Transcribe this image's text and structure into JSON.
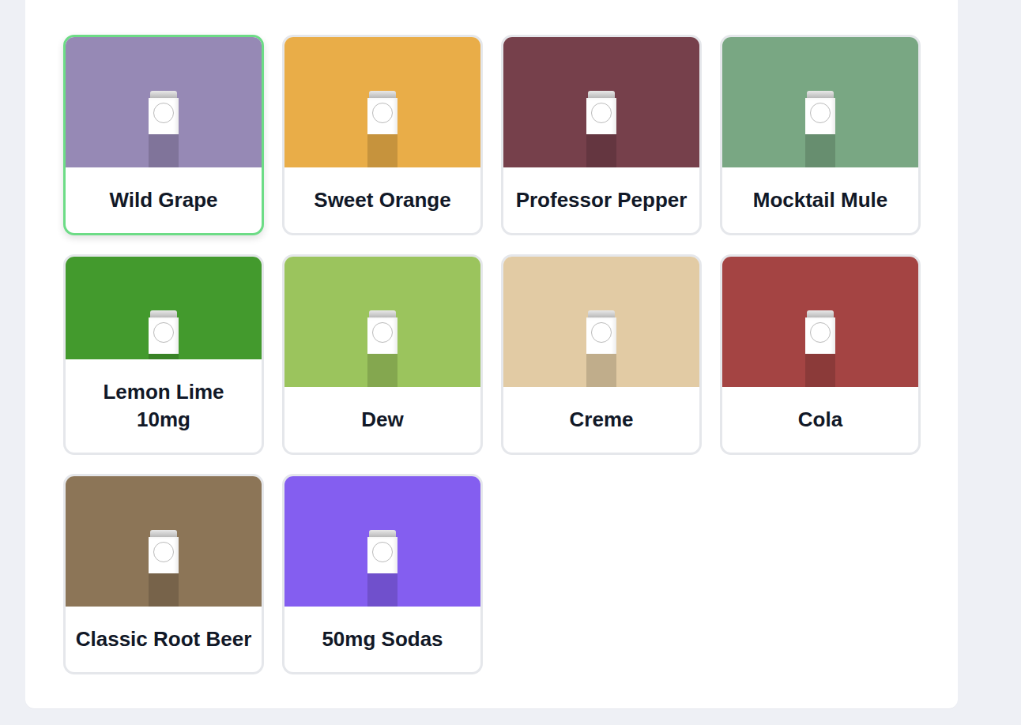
{
  "products": [
    {
      "name": "Wild Grape",
      "color": "#9689b5",
      "selected": true
    },
    {
      "name": "Sweet Orange",
      "color": "#e9ad48",
      "selected": false
    },
    {
      "name": "Professor Pepper",
      "color": "#76404b",
      "selected": false
    },
    {
      "name": "Mocktail Mule",
      "color": "#79a783",
      "selected": false
    },
    {
      "name": "Lemon Lime 10mg",
      "color": "#439a2d",
      "selected": false
    },
    {
      "name": "Dew",
      "color": "#9bc45d",
      "selected": false
    },
    {
      "name": "Creme",
      "color": "#e2cba4",
      "selected": false
    },
    {
      "name": "Cola",
      "color": "#a44443",
      "selected": false
    },
    {
      "name": "Classic Root Beer",
      "color": "#8c7557",
      "selected": false
    },
    {
      "name": "50mg Sodas",
      "color": "#845ef0",
      "selected": false
    }
  ]
}
